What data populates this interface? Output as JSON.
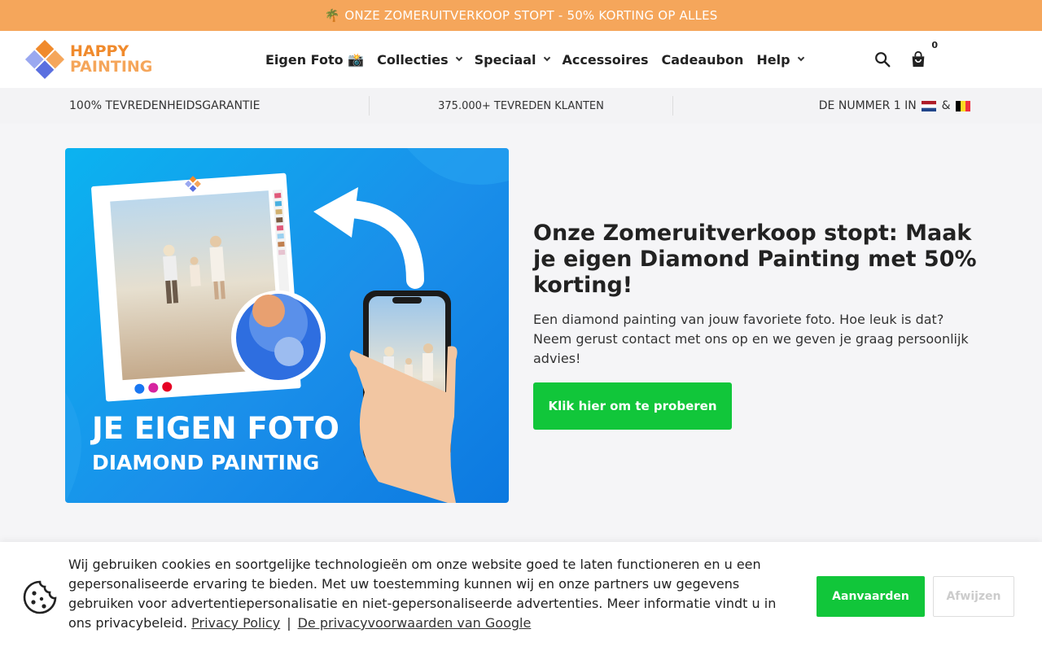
{
  "announcement": {
    "emoji": "🌴",
    "text": "ONZE ZOMERUITVERKOOP STOPT - 50% KORTING OP ALLES"
  },
  "logo": {
    "line1": "HAPPY",
    "line2": "PAINTING"
  },
  "nav": {
    "items": [
      {
        "label": "Eigen Foto 📸",
        "dropdown": false
      },
      {
        "label": "Collecties",
        "dropdown": true
      },
      {
        "label": "Speciaal",
        "dropdown": true
      },
      {
        "label": "Accessoires",
        "dropdown": false
      },
      {
        "label": "Cadeaubon",
        "dropdown": false
      },
      {
        "label": "Help",
        "dropdown": true
      }
    ]
  },
  "cart": {
    "count": "0"
  },
  "usp": {
    "item1": "100% TEVREDENHEIDSGARANTIE",
    "item2": "375.000+ TEVREDEN KLANTEN",
    "item3_prefix": "DE NUMMER 1 IN",
    "item3_joiner": "&"
  },
  "hero": {
    "image_title": "JE EIGEN FOTO",
    "image_subtitle": "DIAMOND PAINTING",
    "title": "Onze Zomeruitverkoop stopt: Maak je eigen Diamond Painting met 50% korting!",
    "description": "Een diamond painting van jouw favoriete foto. Hoe leuk is dat? Neem gerust contact met ons op en we geven je graag persoonlijk advies!",
    "cta_label": "Klik hier om te proberen"
  },
  "cookie": {
    "text": "Wij gebruiken cookies en soortgelijke technologieën om onze website goed te laten functioneren en u een gepersonaliseerde ervaring te bieden. Met uw toestemming kunnen wij en onze partners uw gegevens gebruiken voor advertentiepersonalisatie en niet-gepersonaliseerde advertenties. Meer informatie vindt u in ons privacybeleid.",
    "link1": "Privacy Policy",
    "separator": "|",
    "link2": "De privacyvoorwaarden van Google",
    "accept_label": "Aanvaarden",
    "decline_label": "Afwijzen"
  },
  "colors": {
    "announce_bg": "#f5a65b",
    "accent_green": "#11c63a",
    "logo_orange": "#f08a2c"
  }
}
